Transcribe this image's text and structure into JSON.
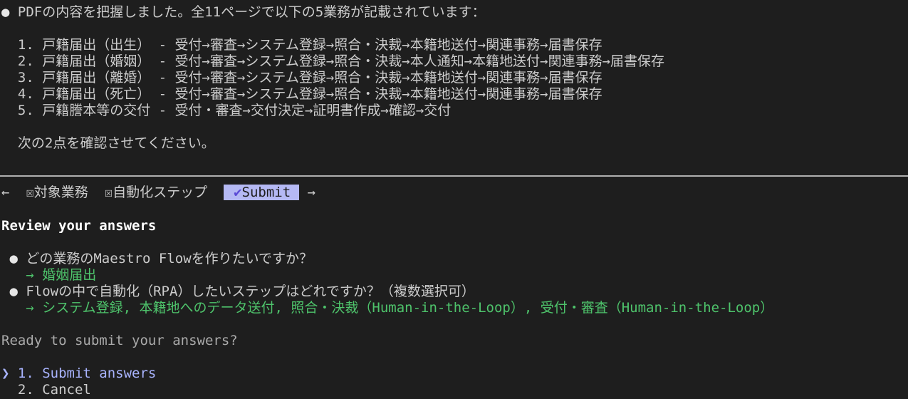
{
  "summary": {
    "bullet": "●",
    "intro": "PDFの内容を把握しました。全11ページで以下の5業務が記載されています：",
    "items": [
      "1. 戸籍届出（出生） - 受付→審査→システム登録→照合・決裁→本籍地送付→関連事務→届書保存",
      "2. 戸籍届出（婚姻） - 受付→審査→システム登録→照合・決裁→本人通知→本籍地送付→関連事務→届書保存",
      "3. 戸籍届出（離婚） - 受付→審査→システム登録→照合・決裁→本籍地送付→関連事務→届書保存",
      "4. 戸籍届出（死亡） - 受付→審査→システム登録→照合・決裁→本籍地送付→関連事務→届書保存",
      "5. 戸籍謄本等の交付 - 受付・審査→交付決定→証明書作成→確認→交付"
    ],
    "confirm_note": "次の2点を確認させてください。"
  },
  "tabs": {
    "prev_arrow": "←",
    "tab1_box": "☒",
    "tab1_label": "対象業務",
    "tab2_box": "☒",
    "tab2_label": "自動化ステップ",
    "submit_check": "✔",
    "submit_label": "Submit",
    "next_arrow": "→"
  },
  "review": {
    "heading": "Review your answers",
    "questions": [
      {
        "bullet": "●",
        "question": "どの業務のMaestro Flowを作りたいですか？",
        "answer": "→ 婚姻届出"
      },
      {
        "bullet": "●",
        "question": "Flowの中で自動化（RPA）したいステップはどれですか？（複数選択可）",
        "answer": "→ システム登録, 本籍地へのデータ送付, 照合・決裁（Human-in-the-Loop）, 受付・審査（Human-in-the-Loop）"
      }
    ],
    "prompt": "Ready to submit your answers?",
    "options": [
      {
        "pointer": "❯",
        "label": "1. Submit answers"
      },
      {
        "pointer": " ",
        "label": "2. Cancel"
      }
    ]
  },
  "colors": {
    "background": "#1e1e1e",
    "text": "#cccccc",
    "answer_green": "#4ec36b",
    "selected_blue": "#a9b4ff",
    "submit_tab_bg": "#b5b9f4"
  }
}
